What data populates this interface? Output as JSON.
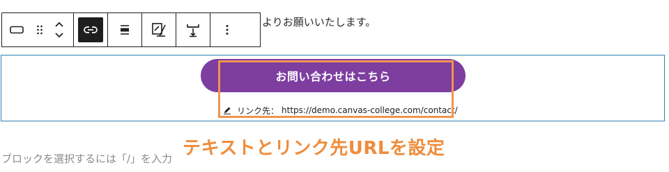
{
  "editor": {
    "previous_paragraph_text": "よりお願いいたします。",
    "placeholder_text": "ブロックを選択するには「/」を入力"
  },
  "toolbar": {
    "tools": [
      {
        "name": "block-type-icon",
        "active": false
      },
      {
        "name": "drag-handle-icon",
        "active": false
      },
      {
        "name": "move-up-down-icon",
        "active": false
      },
      {
        "name": "link-icon",
        "active": true
      },
      {
        "name": "justify-icon",
        "active": false
      },
      {
        "name": "text-color-icon",
        "active": false
      },
      {
        "name": "width-settings-icon",
        "active": false
      },
      {
        "name": "more-options-icon",
        "active": false
      }
    ]
  },
  "button_block": {
    "label": "お問い合わせはこちら",
    "link_label": "リンク先：",
    "link_url": "https://demo.canvas-college.com/contact/",
    "background_color": "#7d3ea0"
  },
  "annotation": {
    "text": "テキストとリンク先URLを設定",
    "color": "#ef8c3c"
  },
  "colors": {
    "selection_border": "#2f7fb5",
    "highlight_border": "#f0944e"
  }
}
